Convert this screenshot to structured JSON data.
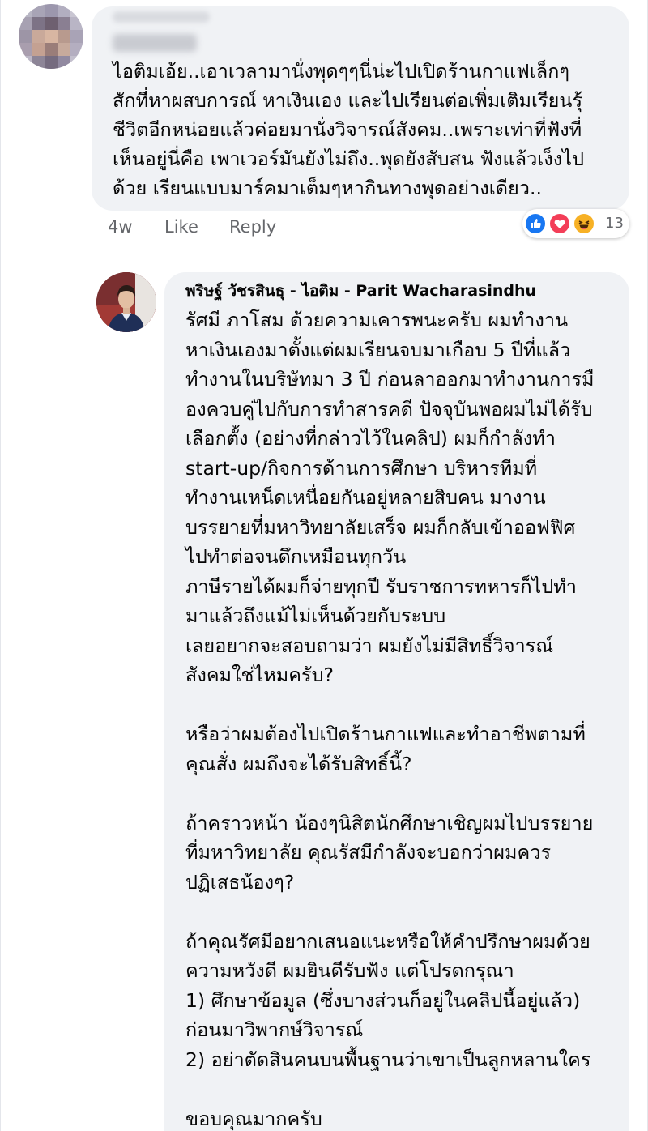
{
  "comment": {
    "text": "ไอติมเอ้ย..เอาเวลามานั่งพุดๆๆนี่น่ะไปเปิดร้านกาแฟเล็กๆ\nสักที่หาผสบการณ์ หาเงินเอง และไปเรียนต่อเพิ่มเติมเรียนรุ้\nชีวิตอีกหน่อยแล้วค่อยมานั่งวิจารณ์สังคม..เพราะเท่าที่ฟังที่\nเห็นอยู่นี่คือ เพาเวอร์มันยังไม่ถึง..พุดยังสับสน ฟังแล้วเง็งไป\nด้วย เรียนแบบมาร์คมาเต็มๆหากินทางพุดอย่างเดียว..",
    "time": "4w",
    "like_label": "Like",
    "reply_label": "Reply",
    "reaction_icons": [
      "like-icon",
      "love-icon",
      "haha-icon"
    ],
    "reaction_colors": {
      "like": "#1877f2",
      "love": "#f33e58",
      "haha": "#f7b125"
    },
    "reaction_count": "13"
  },
  "reply": {
    "author": "พริษฐ์ วัชรสินธุ - ไอติม - Parit Wacharasindhu",
    "text": "รัศมี ภาโสม ด้วยความเคารพนะครับ ผมทำงาน\nหาเงินเองมาตั้งแต่ผมเรียนจบมาเกือบ 5 ปีที่แล้ว\nทำงานในบริษัทมา 3 ปี ก่อนลาออกมาทำงานการมื\nองควบคู่ไปกับการทำสารคดี ปัจจุบันพอผมไม่ได้รับ\nเลือกตั้ง (อย่างที่กล่าวไว้ในคลิป) ผมก็กำลังทำ\nstart-up/กิจการด้านการศึกษา บริหารทีมที่\nทำงานเหน็ดเหนื่อยกันอยู่หลายสิบคน มางาน\nบรรยายที่มหาวิทยาลัยเสร็จ ผมก็กลับเข้าออฟฟิศ\nไปทำต่อจนดึกเหมือนทุกวัน\nภาษีรายได้ผมก็จ่ายทุกปี รับราชการทหารก็ไปทำ\nมาแล้วถึงแม้ไม่เห็นด้วยกับระบบ\nเลยอยากจะสอบถามว่า ผมยังไม่มีสิทธิ์วิจารณ์\nสังคมใช่ไหมครับ?\n\nหรือว่าผมต้องไปเปิดร้านกาแฟและทำอาชีพตามที่\nคุณสั่ง ผมถึงจะได้รับสิทธิ์นี้?\n\nถ้าคราวหน้า น้องๆนิสิตนักศึกษาเชิญผมไปบรรยาย\nที่มหาวิทยาลัย คุณรัสมีกำลังจะบอกว่าผมควร\nปฏิเสธน้องๆ?\n\nถ้าคุณรัศมีอยากเสนอแนะหรือให้คำปรึกษาผมด้วย\nความหวังดี ผมยินดีรับฟัง แต่โปรดกรุณา\n1) ศึกษาข้อมูล (ซึ่งบางส่วนก็อยู่ในคลิปนี้อยู่แล้ว)\nก่อนมาวิพากษ์วิจารณ์\n2) อย่าตัดสินคนบนพื้นฐานว่าเขาเป็นลูกหลานใคร\n\nขอบคุณมากครับ"
  },
  "colors": {
    "bubble": "#f0f2f5",
    "text": "#050505",
    "secondary_text": "#65676b"
  }
}
